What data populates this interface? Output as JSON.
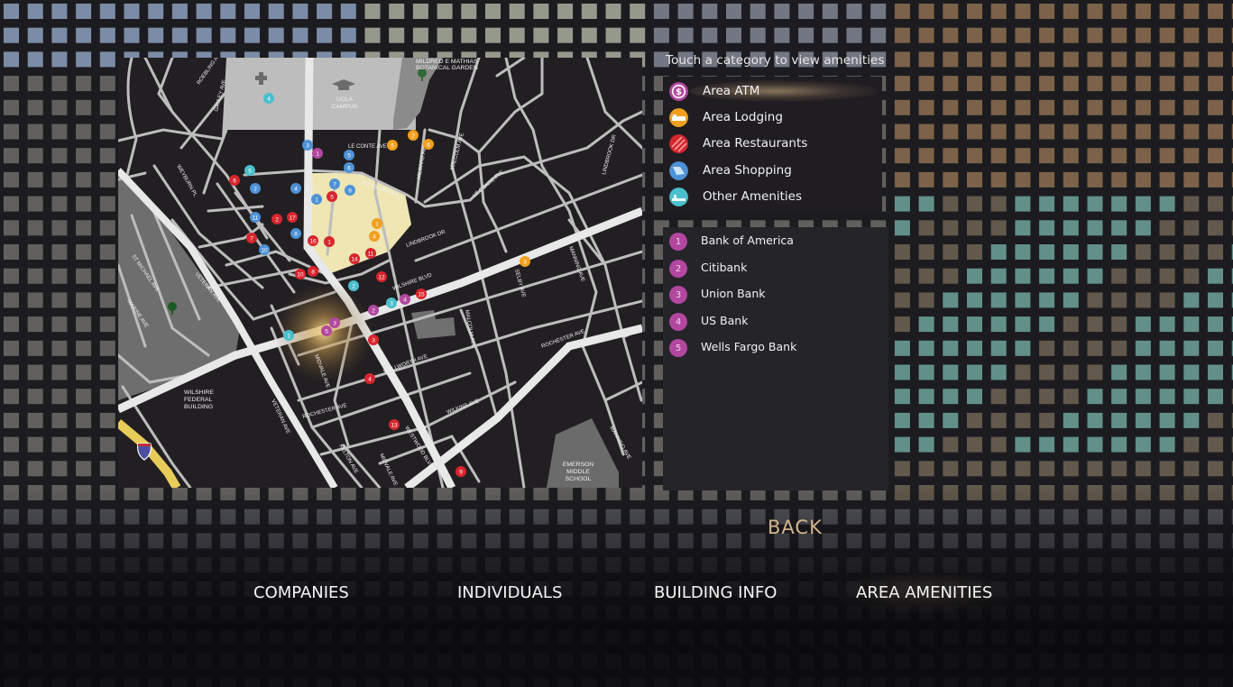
{
  "panel": {
    "title": "Touch a category to view amenities"
  },
  "categories": [
    {
      "label": "Area ATM",
      "icon": "dollar-icon",
      "color": "#b2479f",
      "active": true
    },
    {
      "label": "Area Lodging",
      "icon": "bed-icon",
      "color": "#f0a01e",
      "active": false
    },
    {
      "label": "Area Restaurants",
      "icon": "utensils-icon",
      "color": "#d8262e",
      "active": false
    },
    {
      "label": "Area Shopping",
      "icon": "shopping-bag-icon",
      "color": "#4e92d6",
      "active": false
    },
    {
      "label": "Other Amenities",
      "icon": "spa-icon",
      "color": "#4bbfcc",
      "active": false
    }
  ],
  "atm_list": [
    {
      "num": "1",
      "label": "Bank of America"
    },
    {
      "num": "2",
      "label": "Citibank"
    },
    {
      "num": "3",
      "label": "Union Bank"
    },
    {
      "num": "4",
      "label": "US Bank"
    },
    {
      "num": "5",
      "label": "Wells Fargo Bank"
    }
  ],
  "back_label": "BACK",
  "nav": [
    {
      "label": "COMPANIES",
      "active": false
    },
    {
      "label": "INDIVIDUALS",
      "active": false
    },
    {
      "label": "BUILDING INFO",
      "active": false
    },
    {
      "label": "AREA AMENITIES",
      "active": true
    }
  ],
  "map": {
    "labels": {
      "garden_1": "MILDRED E MATHIAS",
      "garden_2": "BOTANICAL GARDEN",
      "ucla_1": "UCLA",
      "ucla_2": "CAMPUS",
      "federal_1": "WILSHIRE",
      "federal_2": "FEDERAL",
      "federal_3": "BUILDING",
      "emerson_1": "EMERSON",
      "emerson_2": "MIDDLE",
      "emerson_3": "SCHOOL"
    },
    "streets": [
      {
        "name": "ROEBLING AVE"
      },
      {
        "name": "GAYLEY AVE"
      },
      {
        "name": "LE CONTE AVE"
      },
      {
        "name": "WESTWOOD BLVD"
      },
      {
        "name": "WEYBURN PL"
      },
      {
        "name": "WEYBURN AVE"
      },
      {
        "name": "HILGARD AVE"
      },
      {
        "name": "MALCOLM AVE"
      },
      {
        "name": "LE CONTE AVE"
      },
      {
        "name": "LINDBROOK DR"
      },
      {
        "name": "LINDBROOK DR"
      },
      {
        "name": "WILSHIRE BLVD"
      },
      {
        "name": "VETERAN AVE"
      },
      {
        "name": "ST MICHAEL AVE"
      },
      {
        "name": "MARINE AVE"
      },
      {
        "name": "MALCOLM AVE"
      },
      {
        "name": "SELBY AVE"
      },
      {
        "name": "MANNING AVE"
      },
      {
        "name": "ROCHESTER AVE"
      },
      {
        "name": "WELLWORTH AVE"
      },
      {
        "name": "MIDVALE AVE"
      },
      {
        "name": "VETERAN AVE"
      },
      {
        "name": "ROCHESTER AVE"
      },
      {
        "name": "WILKINS AVE"
      },
      {
        "name": "OHIO AVE"
      },
      {
        "name": "WESTWOOD BLVD"
      },
      {
        "name": "KELTON AVE"
      },
      {
        "name": "MIDVALE AVE"
      },
      {
        "name": "MANNING AVE"
      }
    ],
    "pins": [
      {
        "cat": "other",
        "n": "4"
      },
      {
        "cat": "shopping",
        "n": "3"
      },
      {
        "cat": "atm",
        "n": "1"
      },
      {
        "cat": "shopping",
        "n": "5"
      },
      {
        "cat": "shopping",
        "n": "6"
      },
      {
        "cat": "lodging",
        "n": "5"
      },
      {
        "cat": "lodging",
        "n": "2"
      },
      {
        "cat": "lodging",
        "n": "6"
      },
      {
        "cat": "restaurant",
        "n": "6"
      },
      {
        "cat": "other",
        "n": "5"
      },
      {
        "cat": "shopping",
        "n": "2"
      },
      {
        "cat": "shopping",
        "n": "4"
      },
      {
        "cat": "shopping",
        "n": "7"
      },
      {
        "cat": "shopping",
        "n": "9"
      },
      {
        "cat": "shopping",
        "n": "1"
      },
      {
        "cat": "restaurant",
        "n": "5"
      },
      {
        "cat": "shopping",
        "n": "11"
      },
      {
        "cat": "restaurant",
        "n": "2"
      },
      {
        "cat": "restaurant",
        "n": "17"
      },
      {
        "cat": "shopping",
        "n": "8"
      },
      {
        "cat": "restaurant",
        "n": "7"
      },
      {
        "cat": "restaurant",
        "n": "16"
      },
      {
        "cat": "restaurant",
        "n": "1"
      },
      {
        "cat": "lodging",
        "n": "1"
      },
      {
        "cat": "lodging",
        "n": "4"
      },
      {
        "cat": "shopping",
        "n": "10"
      },
      {
        "cat": "restaurant",
        "n": "14"
      },
      {
        "cat": "restaurant",
        "n": "11"
      },
      {
        "cat": "restaurant",
        "n": "10"
      },
      {
        "cat": "restaurant",
        "n": "8"
      },
      {
        "cat": "restaurant",
        "n": "12"
      },
      {
        "cat": "other",
        "n": "2"
      },
      {
        "cat": "restaurant",
        "n": "15"
      },
      {
        "cat": "atm",
        "n": "4"
      },
      {
        "cat": "other",
        "n": "3"
      },
      {
        "cat": "atm",
        "n": "2"
      },
      {
        "cat": "atm",
        "n": "3"
      },
      {
        "cat": "atm",
        "n": "5"
      },
      {
        "cat": "other",
        "n": "1"
      },
      {
        "cat": "restaurant",
        "n": "3"
      },
      {
        "cat": "lodging",
        "n": "3"
      },
      {
        "cat": "restaurant",
        "n": "4"
      },
      {
        "cat": "restaurant",
        "n": "13"
      },
      {
        "cat": "restaurant",
        "n": "9"
      }
    ],
    "colors": {
      "atm": "#b2479f",
      "lodging": "#f0a01e",
      "restaurant": "#d8262e",
      "shopping": "#4e92d6",
      "other": "#4bbfcc"
    }
  }
}
